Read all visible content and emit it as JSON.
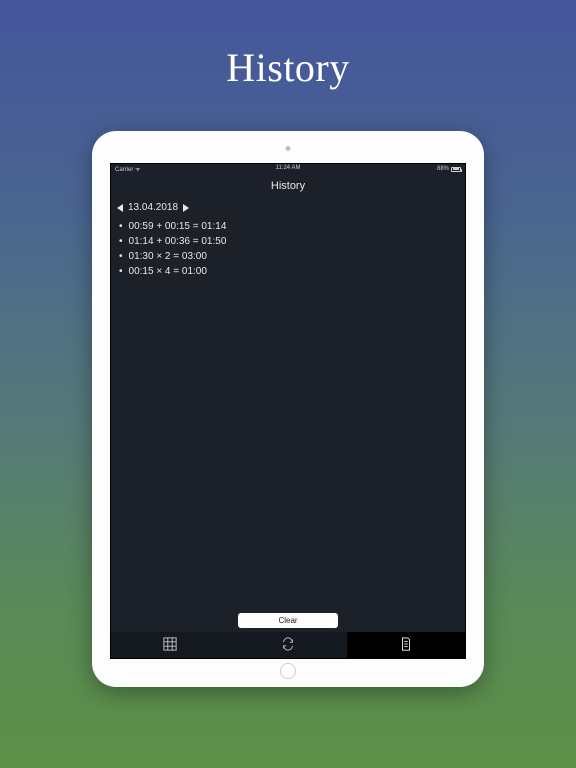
{
  "page": {
    "title": "History"
  },
  "status_bar": {
    "left": "Carrier ᯤ",
    "time": "11:24 AM",
    "battery_pct": "88%"
  },
  "nav": {
    "title": "History"
  },
  "date_picker": {
    "date": "13.04.2018"
  },
  "history": {
    "items": [
      "00:59 + 00:15 = 01:14",
      "01:14 + 00:36 = 01:50",
      "01:30 × 2 = 03:00",
      "00:15 × 4 = 01:00"
    ]
  },
  "toolbar": {
    "clear_label": "Clear"
  },
  "tabs": {
    "items": [
      {
        "name": "calculator"
      },
      {
        "name": "refresh"
      },
      {
        "name": "history"
      }
    ],
    "active_index": 2
  }
}
